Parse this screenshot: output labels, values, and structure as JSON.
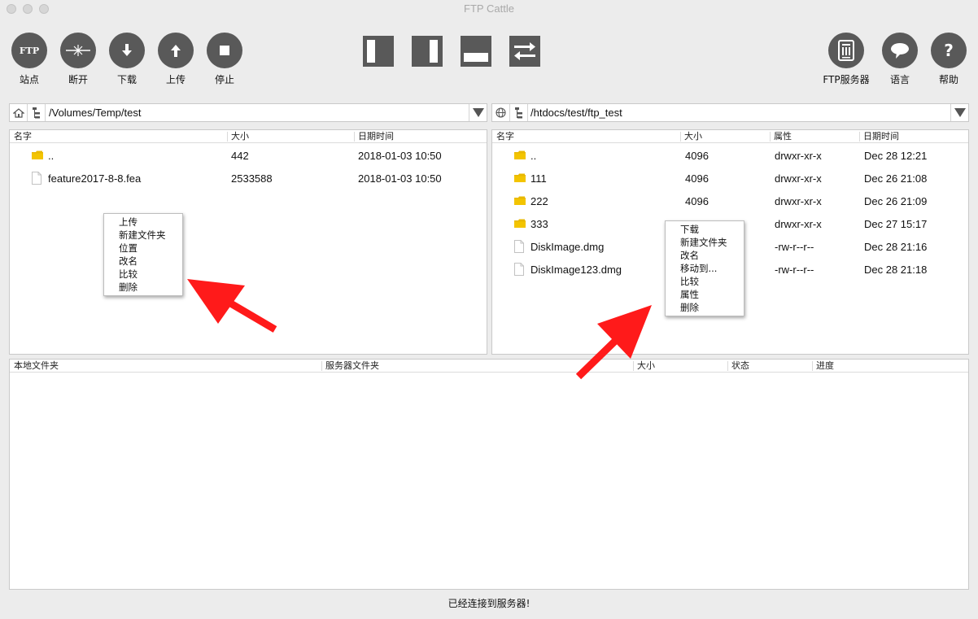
{
  "window": {
    "title": "FTP Cattle"
  },
  "toolbar": {
    "buttons": [
      {
        "label": "站点",
        "icon": "ftp-icon",
        "glyph": "FTP"
      },
      {
        "label": "断开",
        "icon": "disconnect-icon"
      },
      {
        "label": "下载",
        "icon": "arrow-down-icon"
      },
      {
        "label": "上传",
        "icon": "arrow-up-icon"
      },
      {
        "label": "停止",
        "icon": "stop-icon"
      }
    ],
    "layout_icons": [
      "left-pane-icon",
      "right-pane-icon",
      "bottom-pane-icon",
      "swap-icon"
    ],
    "right_buttons": [
      {
        "label": "FTP服务器",
        "icon": "server-icon"
      },
      {
        "label": "语言",
        "icon": "speech-bubble-icon"
      },
      {
        "label": "帮助",
        "icon": "help-icon",
        "glyph": "?"
      }
    ]
  },
  "local": {
    "path": "/Volumes/Temp/test",
    "columns": [
      "名字",
      "大小",
      "日期时间"
    ],
    "files": [
      {
        "type": "folder",
        "name": "..",
        "size": "442",
        "date": "2018-01-03 10:50"
      },
      {
        "type": "file",
        "name": "feature2017-8-8.fea",
        "size": "2533588",
        "date": "2018-01-03 10:50"
      }
    ],
    "context_menu": [
      "上传",
      "新建文件夹",
      "位置",
      "改名",
      "比较",
      "删除"
    ]
  },
  "remote": {
    "path": "/htdocs/test/ftp_test",
    "columns": [
      "名字",
      "大小",
      "属性",
      "日期时间"
    ],
    "files": [
      {
        "type": "folder",
        "name": "..",
        "size": "4096",
        "attr": "drwxr-xr-x",
        "date": "Dec 28 12:21"
      },
      {
        "type": "folder",
        "name": "111",
        "size": "4096",
        "attr": "drwxr-xr-x",
        "date": "Dec 26 21:08"
      },
      {
        "type": "folder",
        "name": "222",
        "size": "4096",
        "attr": "drwxr-xr-x",
        "date": "Dec 26 21:09"
      },
      {
        "type": "folder",
        "name": "333",
        "size": "",
        "attr": "drwxr-xr-x",
        "date": "Dec 27 15:17"
      },
      {
        "type": "file",
        "name": "DiskImage.dmg",
        "size": "",
        "attr": "-rw-r--r--",
        "date": "Dec 28 21:16"
      },
      {
        "type": "file",
        "name": "DiskImage123.dmg",
        "size": "",
        "attr": "-rw-r--r--",
        "date": "Dec 28 21:18"
      }
    ],
    "context_menu": [
      "下载",
      "新建文件夹",
      "改名",
      "移动到...",
      "比较",
      "属性",
      "删除"
    ]
  },
  "transfer": {
    "columns": [
      "本地文件夹",
      "服务器文件夹",
      "大小",
      "状态",
      "进度"
    ]
  },
  "status": "已经连接到服务器!",
  "colors": {
    "button": "#595959",
    "folder": "#e8b800",
    "arrow": "#ff1a1a"
  }
}
